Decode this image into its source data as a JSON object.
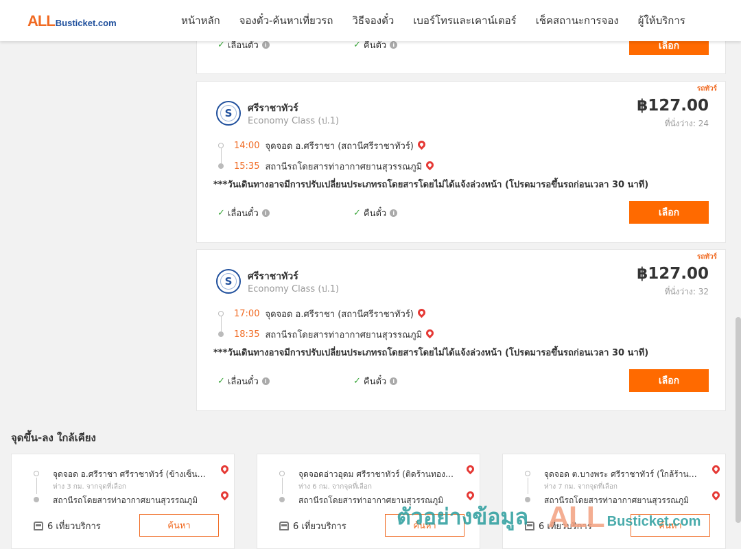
{
  "header": {
    "logo_all": "ALL",
    "logo_rest": "Busticket.com",
    "nav": [
      "หน้าหลัก",
      "จองตั๋ว-ค้นหาเที่ยวรถ",
      "วิธีจองตั๋ว",
      "เบอร์โทรและเคาน์เตอร์",
      "เช็คสถานะการจอง",
      "ผู้ให้บริการ"
    ]
  },
  "common": {
    "feature_reschedule": "เลื่อนตั๋ว",
    "feature_refund": "คืนตั๋ว",
    "select_label": "เลือก",
    "tag": "รถทัวร์",
    "notice": "***วันเดินทางอาจมีการปรับเปลี่ยนประเภทรถโดยสารโดยไม่ได้แจ้งล่วงหน้า (โปรดมารอขึ้นรถก่อนเวลา 30 นาที)",
    "logo_letter": "S"
  },
  "trips": [
    {
      "operator": "ศรีราชาทัวร์",
      "class": "Economy Class (ป.1)",
      "price": "฿127.00",
      "seats": "ที่นั่งว่าง: 24",
      "depart_time": "14:00",
      "depart_place": "จุดจอด อ.ศรีราชา (สถานีศรีราชาทัวร์)",
      "arrive_time": "15:35",
      "arrive_place": "สถานีรถโดยสารท่าอากาศยานสุวรรณภูมิ"
    },
    {
      "operator": "ศรีราชาทัวร์",
      "class": "Economy Class (ป.1)",
      "price": "฿127.00",
      "seats": "ที่นั่งว่าง: 32",
      "depart_time": "17:00",
      "depart_place": "จุดจอด อ.ศรีราชา (สถานีศรีราชาทัวร์)",
      "arrive_time": "18:35",
      "arrive_place": "สถานีรถโดยสารท่าอากาศยานสุวรรณภูมิ"
    }
  ],
  "nearby": {
    "title": "จุดขึ้น-ลง ใกล้เคียง",
    "search_label": "ค้นหา",
    "items": [
      {
        "from": "จุดจอด อ.ศรีราชา ศรีราชาทัวร์ (ข้างเซ็นทรัล)",
        "distance": "ห่าง 3 กม. จากจุดที่เลือก",
        "to": "สถานีรถโดยสารท่าอากาศยานสุวรรณภูมิ",
        "trips": "6 เที่ยวบริการ"
      },
      {
        "from": "จุดจอดอ่าวอุดม ศรีราชาทัวร์ (ติดร้านทองคำ)",
        "distance": "ห่าง 6 กม. จากจุดที่เลือก",
        "to": "สถานีรถโดยสารท่าอากาศยานสุวรรณภูมิ",
        "trips": "6 เที่ยวบริการ"
      },
      {
        "from": "จุดจอด ต.บางพระ ศรีราชาทัวร์ (ใกล้ร้านอาหาร)",
        "distance": "ห่าง 7 กม. จากจุดที่เลือก",
        "to": "สถานีรถโดยสารท่าอากาศยานสุวรรณภูมิ",
        "trips": "6 เที่ยวบริการ"
      }
    ]
  },
  "watermark": {
    "text": "ตัวอย่างข้อมูล",
    "all": "ALL",
    "rest": "Busticket.com"
  },
  "colors": {
    "accent": "#ff6a00",
    "time": "#f06a22",
    "check": "#3aa63a",
    "pin": "#e53935"
  }
}
